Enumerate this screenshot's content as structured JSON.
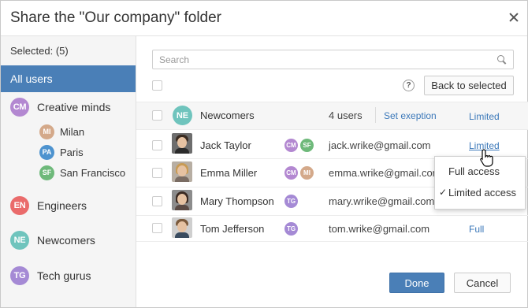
{
  "dialog": {
    "title": "Share the \"Our company\" folder"
  },
  "sidebar": {
    "selected_label": "Selected: (5)",
    "all_users": "All users",
    "groups": [
      {
        "initials": "CM",
        "label": "Creative minds",
        "color": "#b388d1"
      },
      {
        "initials": "EN",
        "label": "Engineers",
        "color": "#ea6b6b"
      },
      {
        "initials": "NE",
        "label": "Newcomers",
        "color": "#6fc4bd"
      },
      {
        "initials": "TG",
        "label": "Tech gurus",
        "color": "#a58ad5"
      }
    ],
    "subgroups": [
      {
        "initials": "MI",
        "label": "Milan",
        "color": "#d4a98a"
      },
      {
        "initials": "PA",
        "label": "Paris",
        "color": "#4d93cf"
      },
      {
        "initials": "SF",
        "label": "San Francisco",
        "color": "#6eb97a"
      }
    ]
  },
  "search": {
    "placeholder": "Search",
    "value": ""
  },
  "toolbar": {
    "help": "?",
    "back_to_selected": "Back to selected"
  },
  "group_row": {
    "initials": "NE",
    "name": "Newcomers",
    "count": "4 users",
    "exception": "Set exeption",
    "access": "Limited",
    "color": "#6fc4bd"
  },
  "users": [
    {
      "name": "Jack Taylor",
      "email": "jack.wrike@gmail.com",
      "access": "Limited",
      "badges": [
        {
          "initials": "CM",
          "color": "#b388d1"
        },
        {
          "initials": "SF",
          "color": "#6eb97a"
        }
      ]
    },
    {
      "name": "Emma Miller",
      "email": "emma.wrike@gmail.com",
      "access": "",
      "badges": [
        {
          "initials": "CM",
          "color": "#b388d1"
        },
        {
          "initials": "MI",
          "color": "#d4a98a"
        }
      ]
    },
    {
      "name": "Mary Thompson",
      "email": "mary.wrike@gmail.com",
      "access": "",
      "badges": [
        {
          "initials": "TG",
          "color": "#a58ad5"
        }
      ]
    },
    {
      "name": "Tom Jefferson",
      "email": "tom.wrike@gmail.com",
      "access": "Full",
      "badges": [
        {
          "initials": "TG",
          "color": "#a58ad5"
        }
      ]
    }
  ],
  "access_menu": {
    "options": [
      {
        "label": "Full access",
        "checked": false
      },
      {
        "label": "Limited access",
        "checked": true
      }
    ],
    "check_mark": "✓"
  },
  "footer": {
    "done": "Done",
    "cancel": "Cancel"
  },
  "colors": {
    "accent": "#4a7fb7",
    "link": "#3b78b9"
  }
}
